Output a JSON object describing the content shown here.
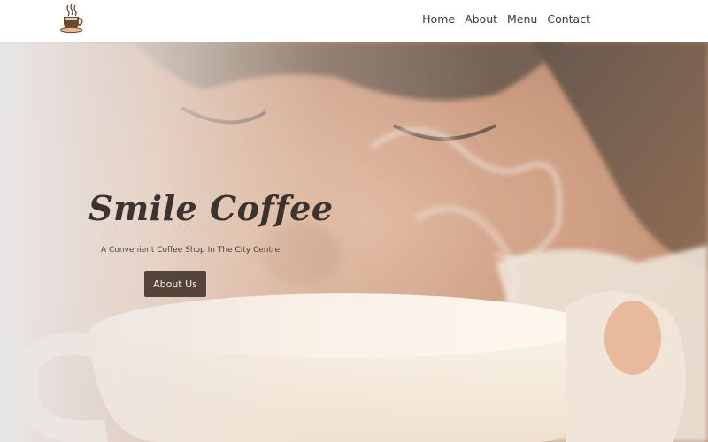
{
  "header": {
    "logo_icon": "coffee-cup-icon",
    "nav": [
      {
        "label": "Home"
      },
      {
        "label": "About"
      },
      {
        "label": "Menu"
      },
      {
        "label": "Contact"
      }
    ]
  },
  "hero": {
    "title": "Smile Coffee",
    "subtitle": "A Convenient Coffee Shop In The City Centre.",
    "button_label": "About Us",
    "colors": {
      "button_bg": "#54443a",
      "title_color": "#3a3330"
    }
  }
}
